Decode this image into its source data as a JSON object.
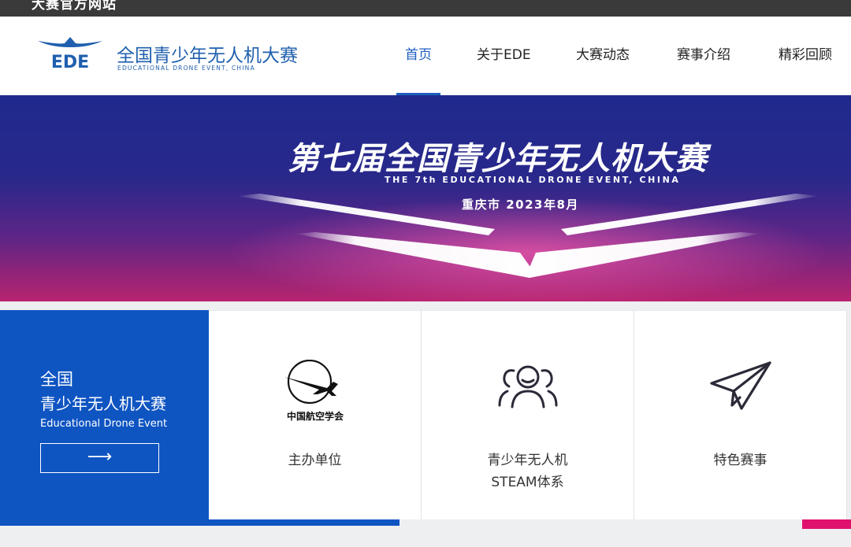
{
  "topbar": {
    "title": "大赛官方网站"
  },
  "logo": {
    "mark_text": "EDE",
    "cn_name": "全国青少年无人机大赛",
    "en_name": "EDUCATIONAL DRONE EVENT, CHINA"
  },
  "nav": {
    "items": [
      {
        "label": "首页",
        "active": true
      },
      {
        "label": "关于EDE"
      },
      {
        "label": "大赛动态"
      },
      {
        "label": "赛事介绍"
      },
      {
        "label": "精彩回顾"
      }
    ]
  },
  "banner": {
    "title": "第七届全国青少年无人机大赛",
    "subtitle": "THE 7th EDUCATIONAL DRONE EVENT, CHINA",
    "date": "重庆市 2023年8月"
  },
  "feature": {
    "line1": "全国",
    "line2": "青少年无人机大赛",
    "line3": "Educational Drone Event",
    "arrow": "⟶"
  },
  "cards": [
    {
      "icon": "aviation-society-logo-icon",
      "logo_text": "中国航空学会",
      "label": "主办单位"
    },
    {
      "icon": "people-group-icon",
      "label_line1": "青少年无人机",
      "label_line2": "STEAM体系"
    },
    {
      "icon": "paper-plane-icon",
      "label": "特色赛事"
    }
  ],
  "colors": {
    "brand_blue": "#0f55c2",
    "nav_active": "#1d5fbf",
    "accent_pink": "#e0116e"
  }
}
